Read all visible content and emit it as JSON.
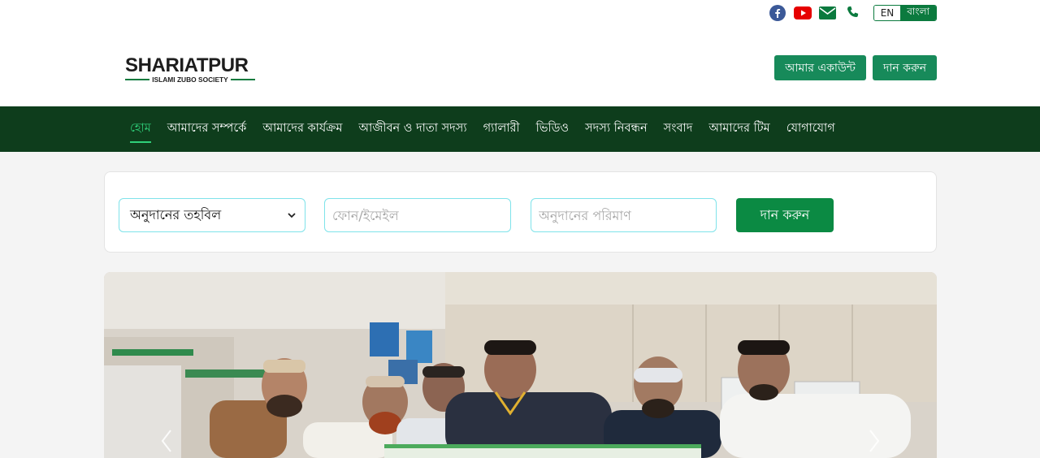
{
  "topbar": {
    "icons": [
      "facebook-icon",
      "youtube-icon",
      "email-icon",
      "phone-icon"
    ],
    "lang_en": "EN",
    "lang_bn": "বাংলা"
  },
  "logo": {
    "title": "SHARIATPUR",
    "subtitle": "ISLAMI ZUBO SOCIETY"
  },
  "header": {
    "account_label": "আমার একাউন্ট",
    "donate_label": "দান করুন"
  },
  "nav": {
    "items": [
      {
        "label": "হোম",
        "active": true
      },
      {
        "label": "আমাদের সম্পর্কে",
        "active": false
      },
      {
        "label": "আমাদের কার্যক্রম",
        "active": false
      },
      {
        "label": "আজীবন ও দাতা সদস্য",
        "active": false
      },
      {
        "label": "গ্যালারী",
        "active": false
      },
      {
        "label": "ভিডিও",
        "active": false
      },
      {
        "label": "সদস্য নিবন্ধন",
        "active": false
      },
      {
        "label": "সংবাদ",
        "active": false
      },
      {
        "label": "আমাদের টিম",
        "active": false
      },
      {
        "label": "যোগাযোগ",
        "active": false
      }
    ]
  },
  "donation": {
    "fund_select_value": "অনুদানের তহবিল",
    "phone_placeholder": "ফোন/ইমেইল",
    "amount_placeholder": "অনুদানের পরিমাণ",
    "submit_label": "দান করুন"
  },
  "hero": {
    "icons": [
      "chevron-left-icon",
      "chevron-right-icon"
    ]
  },
  "colors": {
    "brand_green": "#0b7a3e",
    "nav_bg": "#0e3d1c",
    "nav_active": "#2fd07a",
    "input_border": "#7fe3ea",
    "facebook": "#3b5998",
    "youtube": "#e60000"
  }
}
